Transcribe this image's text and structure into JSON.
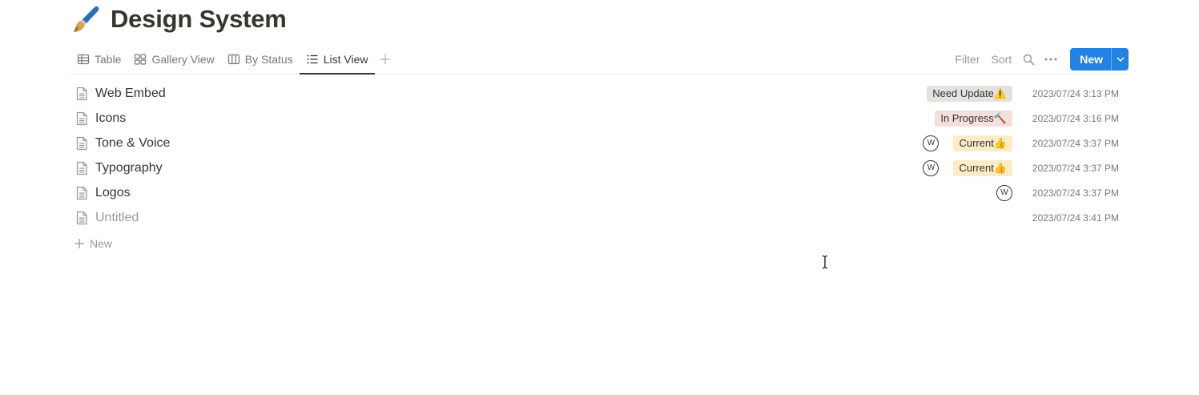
{
  "page": {
    "icon": "paintbrush-icon",
    "title": "Design System"
  },
  "views": {
    "tabs": [
      {
        "label": "Table",
        "icon": "table-icon",
        "active": false
      },
      {
        "label": "Gallery View",
        "icon": "gallery-icon",
        "active": false
      },
      {
        "label": "By Status",
        "icon": "board-icon",
        "active": false
      },
      {
        "label": "List View",
        "icon": "list-icon",
        "active": true
      }
    ],
    "add_icon": "plus-icon"
  },
  "toolbar": {
    "filter_label": "Filter",
    "sort_label": "Sort",
    "search_icon": "search-icon",
    "more_icon": "more-icon",
    "new_label": "New",
    "new_caret_icon": "chevron-down-icon",
    "accent": "#2383e2"
  },
  "rows": [
    {
      "title": "Web Embed",
      "status": "Need Update⚠️",
      "status_color": "#e3e2e0",
      "avatar": "",
      "date": "2023/07/24 3:13 PM"
    },
    {
      "title": "Icons",
      "status": "In Progress🔨",
      "status_color": "#f4dfdb",
      "avatar": "",
      "date": "2023/07/24 3:16 PM"
    },
    {
      "title": "Tone & Voice",
      "status": "Current👍",
      "status_color": "#fbecc8",
      "avatar": "W",
      "date": "2023/07/24 3:37 PM"
    },
    {
      "title": "Typography",
      "status": "Current👍",
      "status_color": "#fbecc8",
      "avatar": "W",
      "date": "2023/07/24 3:37 PM"
    },
    {
      "title": "Logos",
      "status": "",
      "status_color": "",
      "avatar": "W",
      "date": "2023/07/24 3:37 PM"
    },
    {
      "title": "Untitled",
      "status": "",
      "status_color": "",
      "avatar": "",
      "date": "2023/07/24 3:41 PM"
    }
  ],
  "new_row_label": "New"
}
